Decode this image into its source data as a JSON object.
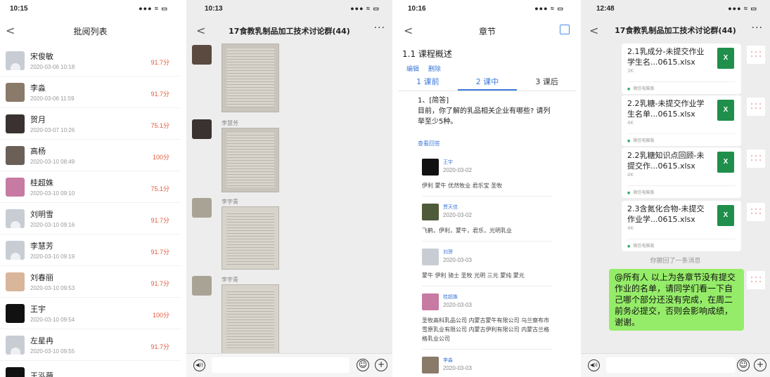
{
  "panel1": {
    "time": "10:15",
    "signal": "●●● ≈ ▭",
    "title": "批阅列表",
    "back": "<",
    "rows": [
      {
        "name": "宋俊敏",
        "time": "2020-03-06 10:18",
        "score": "91.7分",
        "avatar": "#c8cdd4",
        "placeholder": true
      },
      {
        "name": "李淼",
        "time": "2020-03-06 11:59",
        "score": "91.7分",
        "avatar": "#8a7a6a",
        "placeholder": false
      },
      {
        "name": "贺月",
        "time": "2020-03-07 10:26",
        "score": "75.1分",
        "avatar": "#3a3230",
        "placeholder": false
      },
      {
        "name": "高杨",
        "time": "2020-03-10 08:49",
        "score": "100分",
        "avatar": "#6a6058",
        "placeholder": false
      },
      {
        "name": "桂超姝",
        "time": "2020-03-10 09:10",
        "score": "75.1分",
        "avatar": "#c77aa2",
        "placeholder": false
      },
      {
        "name": "刘明雪",
        "time": "2020-03-10 09:16",
        "score": "91.7分",
        "avatar": "#c8cdd4",
        "placeholder": true
      },
      {
        "name": "李慧芳",
        "time": "2020-03-10 09:19",
        "score": "91.7分",
        "avatar": "#c8cdd4",
        "placeholder": true
      },
      {
        "name": "刘春丽",
        "time": "2020-03-10 09:53",
        "score": "91.7分",
        "avatar": "#d9b59a",
        "placeholder": false
      },
      {
        "name": "王宇",
        "time": "2020-03-10 09:54",
        "score": "100分",
        "avatar": "#111111",
        "placeholder": false
      },
      {
        "name": "左星冉",
        "time": "2020-03-10 09:55",
        "score": "91.7分",
        "avatar": "#c8cdd4",
        "placeholder": true
      },
      {
        "name": "王泓薇",
        "time": "",
        "score": "",
        "avatar": "#111111",
        "placeholder": false
      }
    ]
  },
  "panel2": {
    "time": "10:13",
    "title": "17食教乳制品加工技术讨论群(44)",
    "more": "···",
    "back": "<",
    "messages": [
      {
        "name": "李慧芳"
      },
      {
        "name": "李宇青"
      },
      {
        "name": "李宇青"
      }
    ],
    "voice_icon": "◀))",
    "emoji_icon": "☺",
    "plus_icon": "+"
  },
  "panel3": {
    "time": "10:16",
    "title": "章节",
    "back": "<",
    "section": "1.1 课程概述",
    "edit": "编辑",
    "delete": "删除",
    "tabs": [
      "1 课前",
      "2 课中",
      "3 课后"
    ],
    "question": "1、[简答]\n目前，你了解的乳品相关企业有哪些? 请列举至少5种。",
    "view_answers": "查看回答",
    "answers": [
      {
        "name": "王宇",
        "date": "2020-03-02",
        "text": "伊利 蒙牛 优然牧业 君乐宝 圣牧",
        "avatar": "#111111"
      },
      {
        "name": "贾天佳",
        "date": "2020-03-02",
        "text": "飞鹤，伊利，蒙牛，君乐，光明乳业",
        "avatar": "#4e5a3a"
      },
      {
        "name": "刘贺",
        "date": "2020-03-03",
        "text": "蒙牛 伊利 骑士 圣牧 光明 三元 蒙纯 蒙元",
        "avatar": "#c8cdd4"
      },
      {
        "name": "桂超姝",
        "date": "2020-03-03",
        "text": "圣牧高科乳品公司 内蒙古蒙牛有限公司 乌兰察布市雪原乳业有限公司 内蒙古伊利有限公司 内蒙古兰格格乳业公司",
        "avatar": "#c77aa2"
      },
      {
        "name": "李淼",
        "date": "2020-03-03",
        "text": "",
        "avatar": "#8a7a6a"
      }
    ]
  },
  "panel4": {
    "time": "12:48",
    "title": "17食教乳制品加工技术讨论群(44)",
    "more": "···",
    "back": "<",
    "files": [
      {
        "name": "2.1乳成分-未提交作业学生名...0615.xlsx",
        "size": "3K",
        "source": "微信电脑版"
      },
      {
        "name": "2.2乳糖-未提交作业学生名单...0615.xlsx",
        "size": "4K",
        "source": "微信电脑版"
      },
      {
        "name": "2.2乳糖知识点回顾-未提交作...0615.xlsx",
        "size": "4K",
        "source": "微信电脑版"
      },
      {
        "name": "2.3含氮化合物-未提交作业学...0615.xlsx",
        "size": "4K",
        "source": "微信电脑版"
      }
    ],
    "xls_icon": "X",
    "recall": "你撤回了一条消息",
    "message": "@所有人 以上为各章节没有提交作业的名单，请同学们看一下自己哪个部分还没有完成，在周二前务必提交，否则会影响成绩，谢谢。",
    "voice_icon": "◀))",
    "emoji_icon": "☺",
    "plus_icon": "+"
  }
}
